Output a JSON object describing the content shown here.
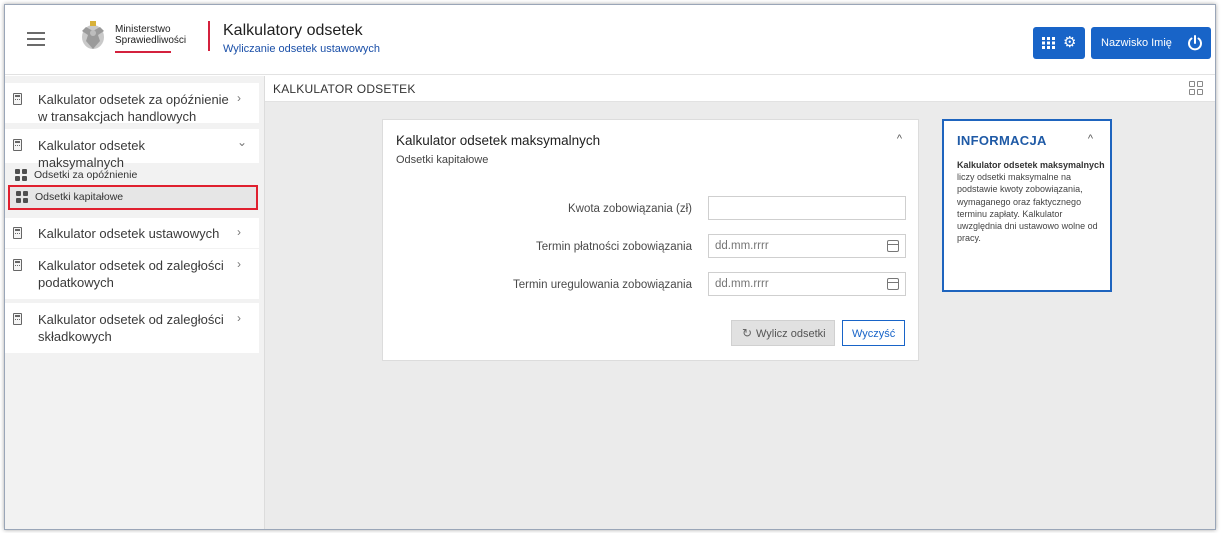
{
  "header": {
    "ministry_line1": "Ministerstwo",
    "ministry_line2": "Sprawiedliwości",
    "app_title": "Kalkulatory odsetek",
    "app_subtitle": "Wyliczanie odsetek ustawowych",
    "user_name": "Nazwisko Imię",
    "accent_color": "#1864c8"
  },
  "sidebar": {
    "items": [
      {
        "label": "Kalkulator odsetek za opóźnienie w transakcjach handlowych",
        "chevron": "›",
        "icon": "calculator-icon"
      },
      {
        "label": "Kalkulator odsetek maksymalnych",
        "chevron": "⌄",
        "icon": "calculator-icon",
        "subitems": [
          {
            "label": "Odsetki za opóźnienie",
            "icon": "grid-icon"
          },
          {
            "label": "Odsetki kapitałowe",
            "icon": "grid-icon",
            "selected": true
          }
        ]
      },
      {
        "label": "Kalkulator odsetek ustawowych",
        "chevron": "›",
        "icon": "calculator-icon"
      },
      {
        "label": "Kalkulator odsetek od zaległości podatkowych",
        "chevron": "›",
        "icon": "calculator-icon"
      },
      {
        "label": "Kalkulator odsetek od zaległości składkowych",
        "chevron": "›",
        "icon": "calculator-icon"
      }
    ]
  },
  "breadcrumb": "KALKULATOR ODSETEK",
  "card": {
    "title": "Kalkulator odsetek maksymalnych",
    "subtitle": "Odsetki kapitałowe",
    "fields": [
      {
        "label": "Kwota zobowiązania (zł)",
        "value": "",
        "placeholder": ""
      },
      {
        "label": "Termin płatności zobowiązania",
        "value": "",
        "placeholder": "dd.mm.rrrr"
      },
      {
        "label": "Termin uregulowania zobowiązania",
        "value": "",
        "placeholder": "dd.mm.rrrr"
      }
    ],
    "calc_button": "Wylicz odsetki",
    "clear_button": "Wyczyść",
    "collapse_glyph": "^"
  },
  "info": {
    "title": "INFORMACJA",
    "bold_text": "Kalkulator odsetek maksymalnych",
    "text": " liczy odsetki maksymalne na podstawie kwoty zobowiązania, wymaganego oraz faktycznego terminu zapłaty. Kalkulator uwzględnia dni ustawowo wolne od pracy.",
    "collapse_glyph": "^"
  }
}
